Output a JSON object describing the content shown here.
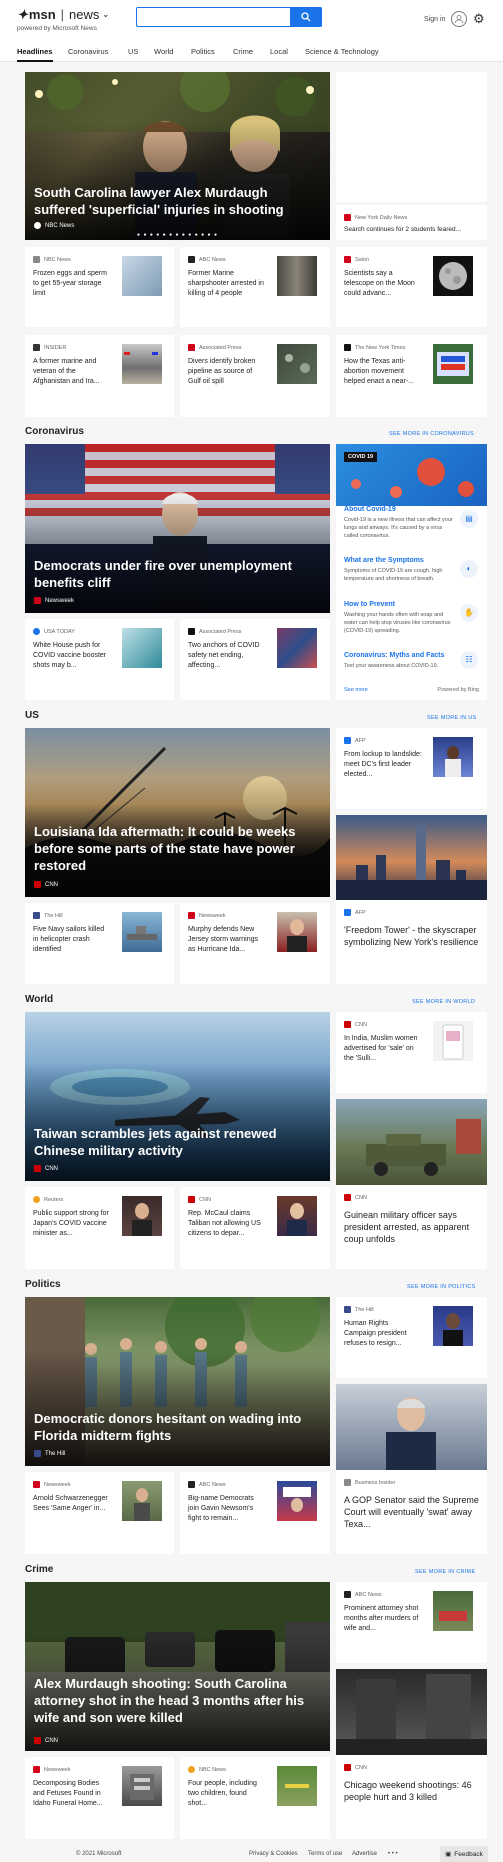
{
  "header": {
    "brand": "msn",
    "section": "news",
    "powered_by": "powered by Microsoft News",
    "search_placeholder": "",
    "signin": "Sign in"
  },
  "nav": [
    "Headlines",
    "Coronavirus",
    "US",
    "World",
    "Politics",
    "Crime",
    "Local",
    "Science & Technology"
  ],
  "top": {
    "hero_title": "South Carolina lawyer Alex Murdaugh suffered 'superficial' injuries in shooting",
    "hero_source": "NBC News",
    "side_source": "New York Daily News",
    "side_title": "Search continues for 2 students feared...",
    "cards": [
      {
        "source": "NBC News",
        "title": "Frozen eggs and sperm to get 55-year storage limit"
      },
      {
        "source": "ABC News",
        "title": "Former Marine sharpshooter arrested in killing of 4 people"
      },
      {
        "source": "Salon",
        "title": "Scientists say a telescope on the Moon could advanc..."
      },
      {
        "source": "INSIDER",
        "title": "A former marine and veteran of the Afghanistan and Ira..."
      },
      {
        "source": "Associated Press",
        "title": "Divers identify broken pipeline as source of Gulf oil spill"
      },
      {
        "source": "The New York Times",
        "title": "How the Texas anti-abortion movement helped enact a near-..."
      }
    ]
  },
  "coronavirus": {
    "label": "Coronavirus",
    "see_more": "SEE MORE IN CORONAVIRUS",
    "hero_title": "Democrats under fire over unemployment benefits cliff",
    "hero_source": "Newsweek",
    "cards": [
      {
        "source": "USA TODAY",
        "title": "White House push for COVID vaccine booster shots may b..."
      },
      {
        "source": "Associated Press",
        "title": "Two anchors of COVID safety net ending, affecting..."
      }
    ],
    "panel": {
      "badge": "COVID 19",
      "items": [
        {
          "h": "About Covid-19",
          "b": "Covid-19 is a new illness that can affect your lungs and airways. It's caused by a virus called coronavirus."
        },
        {
          "h": "What are the Symptoms",
          "b": "Symptoms of COVID-19 are cough, high temperature and shortness of breath."
        },
        {
          "h": "How to Prevent",
          "b": "Washing your hands often with soap and water can help stop viruses like coronavirus (COVID-19) spreading."
        },
        {
          "h": "Coronavirus: Myths and Facts",
          "b": "Test your awareness about COVID-19."
        }
      ],
      "see_more": "See more",
      "powered": "Powered by Bing"
    }
  },
  "us": {
    "label": "US",
    "see_more": "SEE MORE IN US",
    "side_source": "AFP",
    "side_title": "From lockup to landslide: meet DC's first leader elected...",
    "hero_title": "Louisiana Ida aftermath: It could be weeks before some parts of the state have power restored",
    "hero_source": "CNN",
    "cards": [
      {
        "source": "The Hill",
        "title": "Five Navy sailors killed in helicopter crash identified"
      },
      {
        "source": "Newsweek",
        "title": "Murphy defends New Jersey storm warnings as Hurricane Ida..."
      }
    ],
    "photo_source": "AFP",
    "photo_title": "'Freedom Tower' - the skyscraper symbolizing New York's resilience"
  },
  "world": {
    "label": "World",
    "see_more": "SEE MORE IN WORLD",
    "side_source": "CNN",
    "side_title": "In India, Muslim women advertised for 'sale' on the 'Sulli...",
    "hero_title": "Taiwan scrambles jets against renewed Chinese military activity",
    "hero_source": "CNN",
    "cards": [
      {
        "source": "Reuters",
        "title": "Public support strong for Japan's COVID vaccine minister as..."
      },
      {
        "source": "CNN",
        "title": "Rep. McCaul claims Taliban not allowing US citizens to depar..."
      }
    ],
    "photo_source": "CNN",
    "photo_title": "Guinean military officer says president arrested, as apparent coup unfolds"
  },
  "politics": {
    "label": "Politics",
    "see_more": "SEE MORE IN POLITICS",
    "side_source": "The Hill",
    "side_title": "Human Rights Campaign president refuses to resign...",
    "hero_title": "Democratic donors hesitant on wading into Florida midterm fights",
    "hero_source": "The Hill",
    "cards": [
      {
        "source": "Newsweek",
        "title": "Arnold Schwarzenegger Sees 'Same Anger' in..."
      },
      {
        "source": "ABC News",
        "title": "Big-name Democrats join Gavin Newsom's fight to remain..."
      }
    ],
    "photo_source": "Business Insider",
    "photo_title": "A GOP Senator said the Supreme Court will eventually 'swat' away Texa..."
  },
  "crime": {
    "label": "Crime",
    "see_more": "SEE MORE IN CRIME",
    "side_source": "ABC News",
    "side_title": "Prominent attorney shot months after murders of wife and...",
    "hero_title": "Alex Murdaugh shooting: South Carolina attorney shot in the head 3 months after his wife and son were killed",
    "hero_source": "CNN",
    "cards": [
      {
        "source": "Newsweek",
        "title": "Decomposing Bodies and Fetuses Found in Idaho Funeral Home..."
      },
      {
        "source": "NBC News",
        "title": "Four people, including two children, found shot..."
      }
    ],
    "photo_source": "CNN",
    "photo_title": "Chicago weekend shootings: 46 people hurt and 3 killed"
  },
  "footer": {
    "copyright": "© 2021 Microsoft",
    "privacy": "Privacy & Cookies",
    "terms": "Terms of use",
    "advertise": "Advertise",
    "more": "• • •",
    "feedback": "Feedback"
  }
}
